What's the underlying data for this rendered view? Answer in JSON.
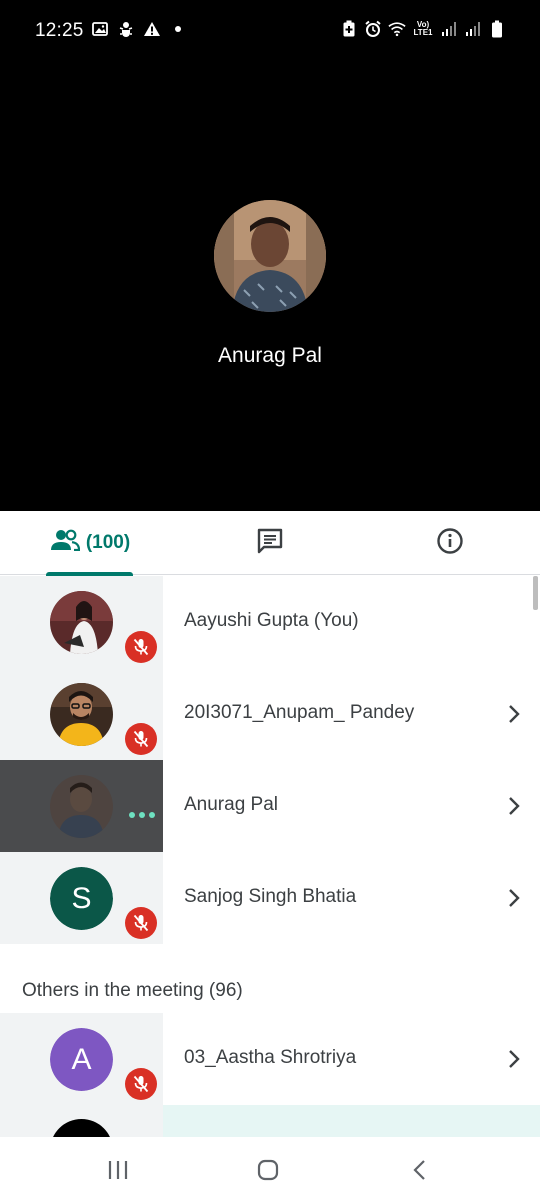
{
  "status_bar": {
    "time": "12:25",
    "left_icons": [
      "image-icon",
      "usb-debug-icon",
      "warning-icon",
      "dot-icon"
    ],
    "right_icons": [
      "battery-saver-icon",
      "alarm-icon",
      "wifi-icon",
      "volte-icon",
      "signal-icon",
      "signal-icon",
      "battery-icon"
    ],
    "volte_label_top": "Vo)",
    "volte_label_bottom": "LTE1"
  },
  "stage": {
    "presenter_name": "Anurag Pal"
  },
  "tabs": {
    "people_count": "(100)",
    "people_icon": "people-icon",
    "chat_icon": "chat-icon",
    "info_icon": "info-icon",
    "accent": "#00796b"
  },
  "participants": [
    {
      "name": "Aayushi Gupta (You)",
      "status": "muted",
      "has_chevron": false
    },
    {
      "name": "20I3071_Anupam_ Pandey",
      "status": "muted",
      "has_chevron": true
    },
    {
      "name": "Anurag Pal",
      "status": "speaking",
      "has_chevron": true
    },
    {
      "name": "Sanjog Singh Bhatia",
      "status": "muted",
      "has_chevron": true,
      "initial": "S",
      "avatar_color": "#0b5748"
    }
  ],
  "others_section": {
    "label": "Others in the meeting (96)",
    "items": [
      {
        "name": "03_Aastha Shrotriya",
        "status": "muted",
        "has_chevron": true,
        "initial": "A",
        "avatar_color": "#7e57c2"
      }
    ]
  },
  "colors": {
    "muted_badge": "#d93025",
    "speaking_dots": "#6ee1c1"
  },
  "nav_bar": {
    "icons": [
      "recent-apps-icon",
      "home-icon",
      "back-icon"
    ]
  }
}
